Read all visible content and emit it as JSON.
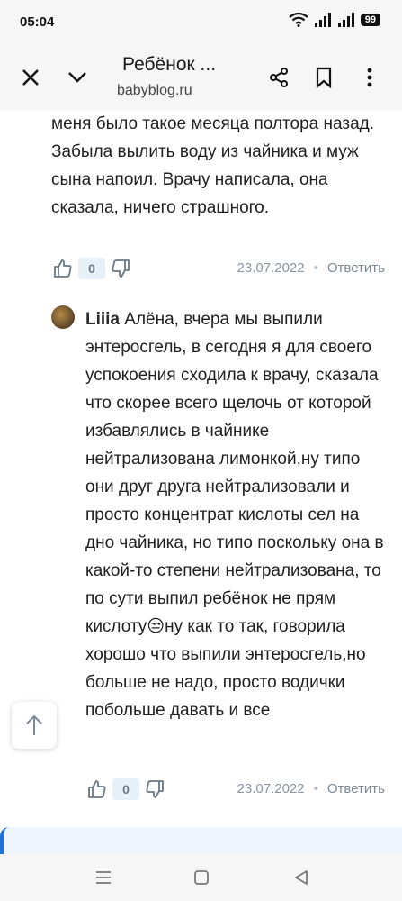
{
  "status": {
    "time": "05:04",
    "battery": "99"
  },
  "toolbar": {
    "title": "Ребёнок ...",
    "url": "babyblog.ru"
  },
  "comments": [
    {
      "text": "меня было такое месяца полтора назад. Забыла вылить воду из чайника и муж сына напоил. Врачу написала, она сказала, ничего страшного.",
      "votes": "0",
      "date": "23.07.2022",
      "reply_label": "Ответить"
    },
    {
      "author": "Liiia",
      "text": "Алёна, вчера мы выпили энтеросгель, в сегодня я для своего успокоения сходила к врачу, сказала что скорее всего щелочь от которой избавлялись в чайнике нейтрализована лимонкой,ну типо они друг друга нейтрализовали и просто концентрат кислоты сел на дно чайника, но типо поскольку она в какой-то степени нейтрализована, то по сути выпил ребёнок не прям кислоту😒ну как то так, говорила хорошо что выпили энтеросгель,но больше не надо, просто водички побольше давать и все",
      "votes": "0",
      "date": "23.07.2022",
      "reply_label": "Ответить"
    }
  ],
  "separator": "•",
  "colors": {
    "accent": "#1e73d8",
    "vote_bg": "#e8f0f7",
    "meta": "#8a96a3"
  }
}
